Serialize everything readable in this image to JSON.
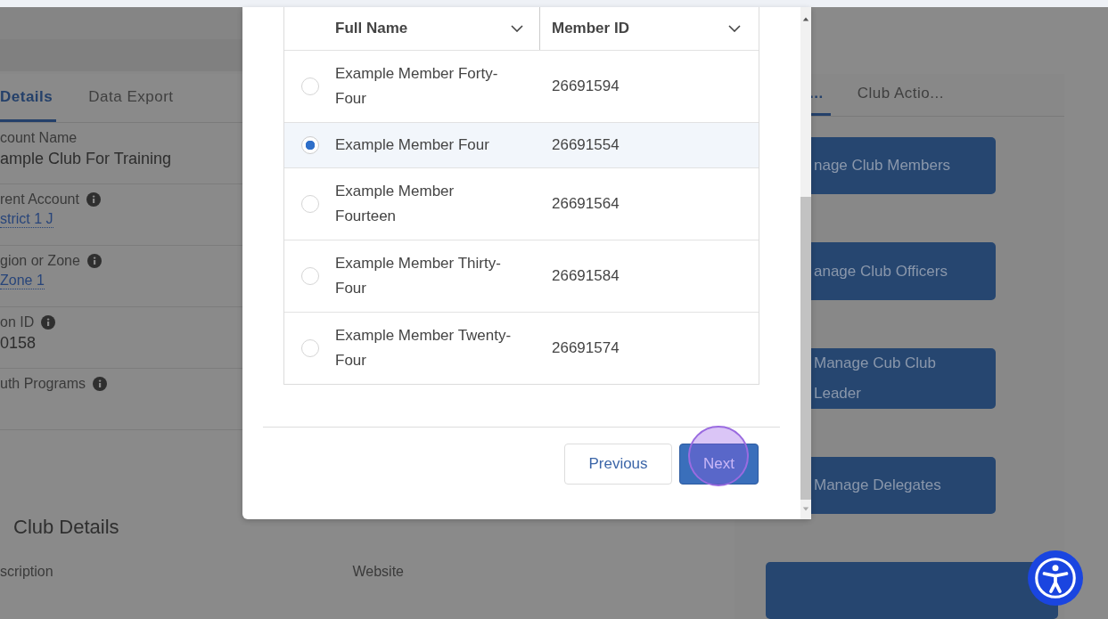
{
  "record_page": {
    "tabs": [
      {
        "label": "Details",
        "selected": true
      },
      {
        "label": "Data Export",
        "selected": false
      }
    ],
    "fields": [
      {
        "label": "count Name",
        "value": "ample Club For Training",
        "info": false,
        "link": false
      },
      {
        "label": "rent Account",
        "value": "strict 1 J",
        "info": true,
        "link": true
      },
      {
        "label": "gion or Zone",
        "value": "Zone 1",
        "info": true,
        "link": true
      },
      {
        "label": "on ID",
        "value": "0158",
        "info": true,
        "link": false
      },
      {
        "label": "uth Programs",
        "info": true
      }
    ],
    "section_title": "Club Details",
    "section_fields": [
      "scription",
      "Website"
    ]
  },
  "actions_panel": {
    "tabs": [
      {
        "label": "...",
        "selected": true
      },
      {
        "label": "Club Actio...",
        "selected": false
      }
    ],
    "buttons": [
      "nage Club Members",
      "anage Club Officers",
      "Manage Cub Club Leader",
      "Manage Delegates"
    ]
  },
  "dialog": {
    "table": {
      "columns": [
        "Full Name",
        "Member ID"
      ],
      "rows": [
        {
          "name": "Example Member Forty-Four",
          "id": "26691594",
          "selected": false
        },
        {
          "name": "Example Member Four",
          "id": "26691554",
          "selected": true
        },
        {
          "name": "Example Member Fourteen",
          "id": "26691564",
          "selected": false
        },
        {
          "name": "Example Member Thirty-Four",
          "id": "26691584",
          "selected": false
        },
        {
          "name": "Example Member Twenty-Four",
          "id": "26691574",
          "selected": false
        }
      ]
    },
    "buttons": {
      "previous": "Previous",
      "next": "Next"
    }
  }
}
